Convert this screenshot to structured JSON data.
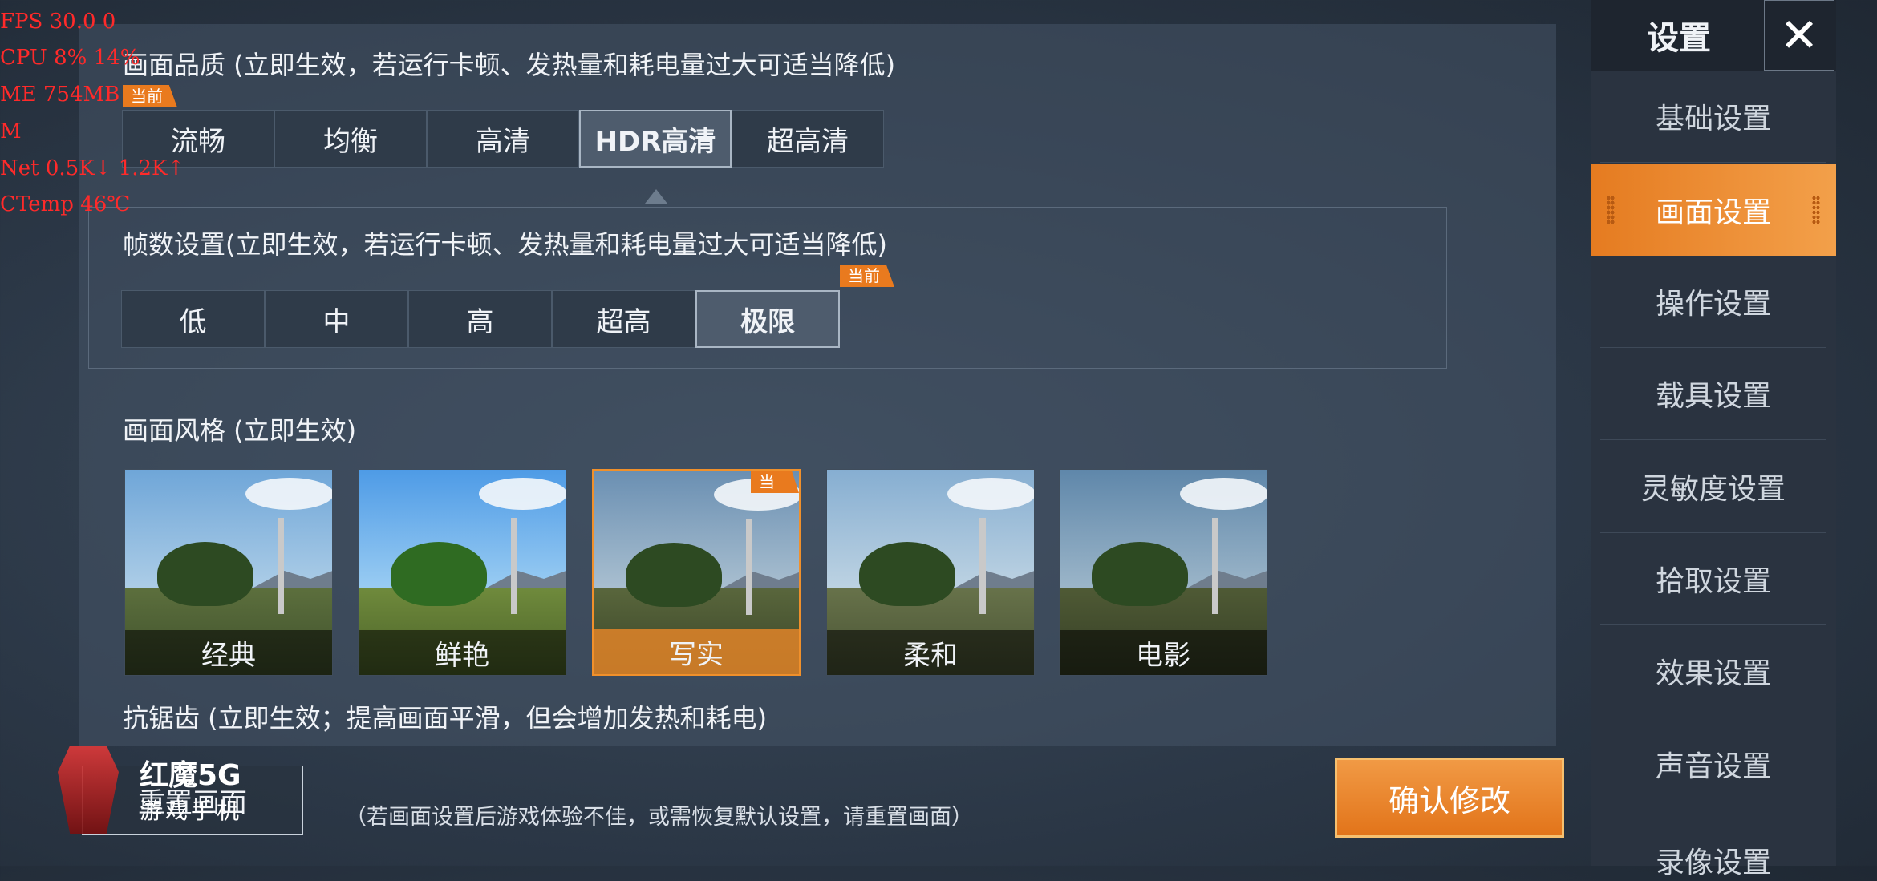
{
  "overlay": {
    "fps": "FPS  30.0  0",
    "cpu": "CPU  8%  14%",
    "mem": "ME   754MB",
    "mem2": "M",
    "net": "Net   0.5K↓  1.2K↑",
    "temp": "CTemp  46℃"
  },
  "graphics_quality": {
    "title": "画面品质 (立即生效，若运行卡顿、发热量和耗电量过大可适当降低)",
    "current_badge": "当前",
    "options": [
      "流畅",
      "均衡",
      "高清",
      "HDR高清",
      "超高清"
    ],
    "selected": "HDR高清"
  },
  "frame_rate": {
    "title": "帧数设置(立即生效，若运行卡顿、发热量和耗电量过大可适当降低)",
    "current_badge": "当前",
    "options": [
      "低",
      "中",
      "高",
      "超高",
      "极限"
    ],
    "selected": "极限"
  },
  "style": {
    "title": "画面风格 (立即生效)",
    "current_badge": "当前",
    "options": [
      "经典",
      "鲜艳",
      "写实",
      "柔和",
      "电影"
    ],
    "selected": "写实"
  },
  "anti_aliasing": {
    "title": "抗锯齿 (立即生效；提高画面平滑，但会增加发热和耗电)"
  },
  "footer": {
    "reset_label": "重置画面",
    "hint": "（若画面设置后游戏体验不佳，或需恢复默认设置，请重置画面）",
    "confirm_label": "确认修改"
  },
  "logo": {
    "line1": "红魔5G",
    "line2": "游戏手机"
  },
  "sidebar": {
    "title": "设置",
    "close_icon": "close-icon",
    "items": [
      {
        "label": "基础设置"
      },
      {
        "label": "画面设置"
      },
      {
        "label": "操作设置"
      },
      {
        "label": "载具设置"
      },
      {
        "label": "灵敏度设置"
      },
      {
        "label": "拾取设置"
      },
      {
        "label": "效果设置"
      },
      {
        "label": "声音设置"
      },
      {
        "label": "录像设置"
      }
    ],
    "active": "画面设置"
  },
  "colors": {
    "accent": "#e97a1e",
    "panel": "#2f3b49"
  }
}
